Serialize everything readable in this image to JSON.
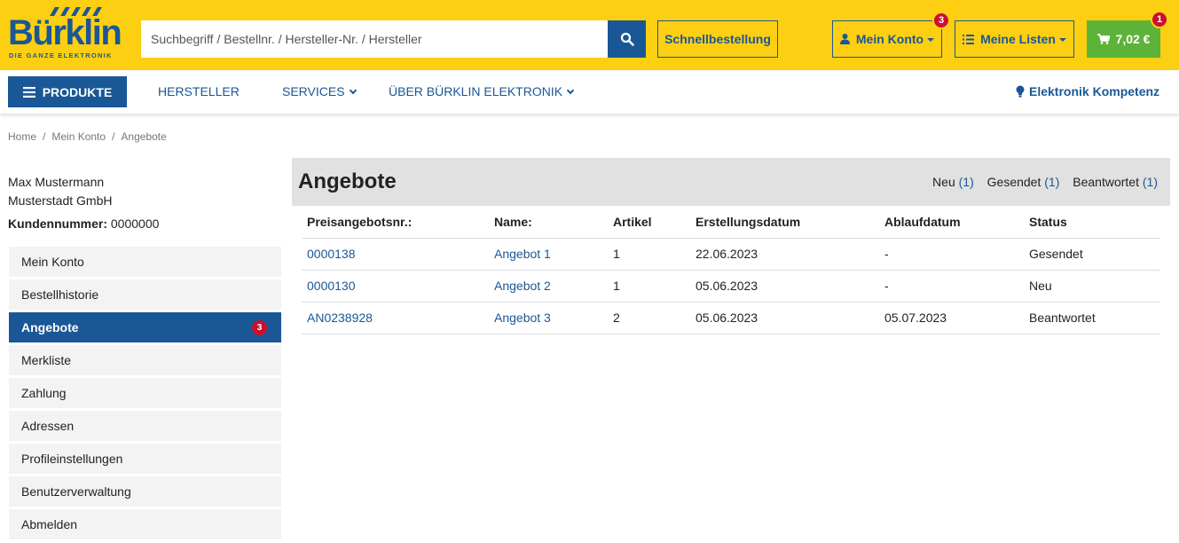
{
  "brand": {
    "name": "Bürklin",
    "tagline": "DIE GANZE ELEKTRONIK",
    "color": "#1a5796",
    "header_bg": "#fdcf13"
  },
  "search": {
    "placeholder": "Suchbegriff / Bestellnr. / Hersteller-Nr. / Hersteller",
    "button_icon": "search-icon"
  },
  "header": {
    "schnellbestellung": "Schnellbestellung",
    "konto": {
      "label": "Mein Konto",
      "badge": "3",
      "icon": "user-icon"
    },
    "listen": {
      "label": "Meine Listen",
      "icon": "list-icon"
    },
    "cart": {
      "label": "7,02 €",
      "badge": "1",
      "icon": "cart-icon",
      "color": "#5cb338"
    }
  },
  "nav": {
    "produkte": "PRODUKTE",
    "hersteller": "HERSTELLER",
    "services": "SERVICES",
    "ueber": "ÜBER BÜRKLIN ELEKTRONIK",
    "kompetenz": "Elektronik Kompetenz"
  },
  "breadcrumb": [
    "Home",
    "Mein Konto",
    "Angebote"
  ],
  "user": {
    "name": "Max Mustermann",
    "company": "Musterstadt GmbH",
    "kundennummer_label": "Kundennummer:",
    "kundennummer": "0000000"
  },
  "sidebar": {
    "items": [
      {
        "label": "Mein Konto"
      },
      {
        "label": "Bestellhistorie"
      },
      {
        "label": "Angebote",
        "badge": "3",
        "active": true
      },
      {
        "label": "Merkliste"
      },
      {
        "label": "Zahlung"
      },
      {
        "label": "Adressen"
      },
      {
        "label": "Profileinstellungen"
      },
      {
        "label": "Benutzerverwaltung"
      },
      {
        "label": "Abmelden"
      }
    ]
  },
  "main": {
    "title": "Angebote",
    "filters": [
      {
        "label": "Neu",
        "count": "(1)"
      },
      {
        "label": "Gesendet",
        "count": "(1)"
      },
      {
        "label": "Beantwortet",
        "count": "(1)"
      }
    ],
    "columns": [
      "Preisangebotsnr.:",
      "Name:",
      "Artikel",
      "Erstellungsdatum",
      "Ablaufdatum",
      "Status"
    ],
    "rows": [
      {
        "nr": "0000138",
        "name": "Angebot 1",
        "artikel": "1",
        "erstellt": "22.06.2023",
        "ablauf": "-",
        "status": "Gesendet"
      },
      {
        "nr": "0000130",
        "name": "Angebot 2",
        "artikel": "1",
        "erstellt": "05.06.2023",
        "ablauf": "-",
        "status": "Neu"
      },
      {
        "nr": "AN0238928",
        "name": "Angebot 3",
        "artikel": "2",
        "erstellt": "05.06.2023",
        "ablauf": "05.07.2023",
        "status": "Beantwortet"
      }
    ]
  }
}
